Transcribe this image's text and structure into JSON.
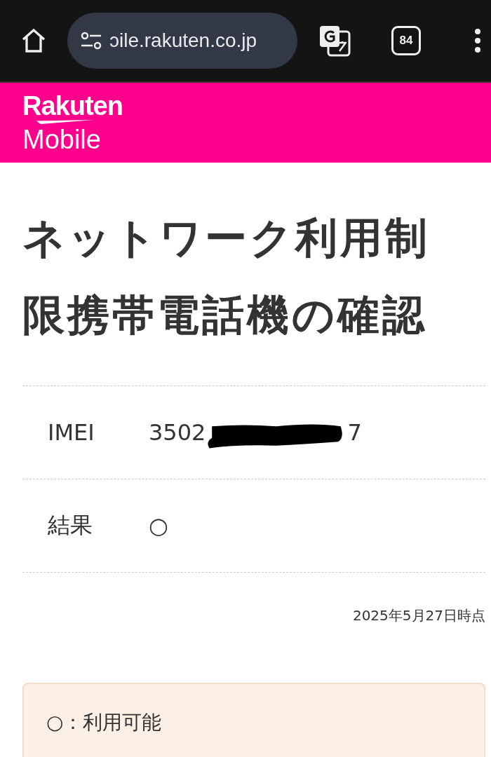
{
  "browser": {
    "url": "ɔile.rakuten.co.jp",
    "tab_count": "84"
  },
  "header": {
    "logo_top": "Rakuten",
    "logo_bottom": "Mobile"
  },
  "title": "ネットワーク利用制限携帯電話機の確認",
  "results": [
    {
      "kind": "redacted",
      "label": "IMEI",
      "value_start": "3502",
      "value_end": "7"
    },
    {
      "kind": "plain",
      "label": "結果",
      "value": "○"
    }
  ],
  "as_of": "2025年5月27日時点",
  "legend": [
    {
      "text": "○：利用可能"
    }
  ]
}
